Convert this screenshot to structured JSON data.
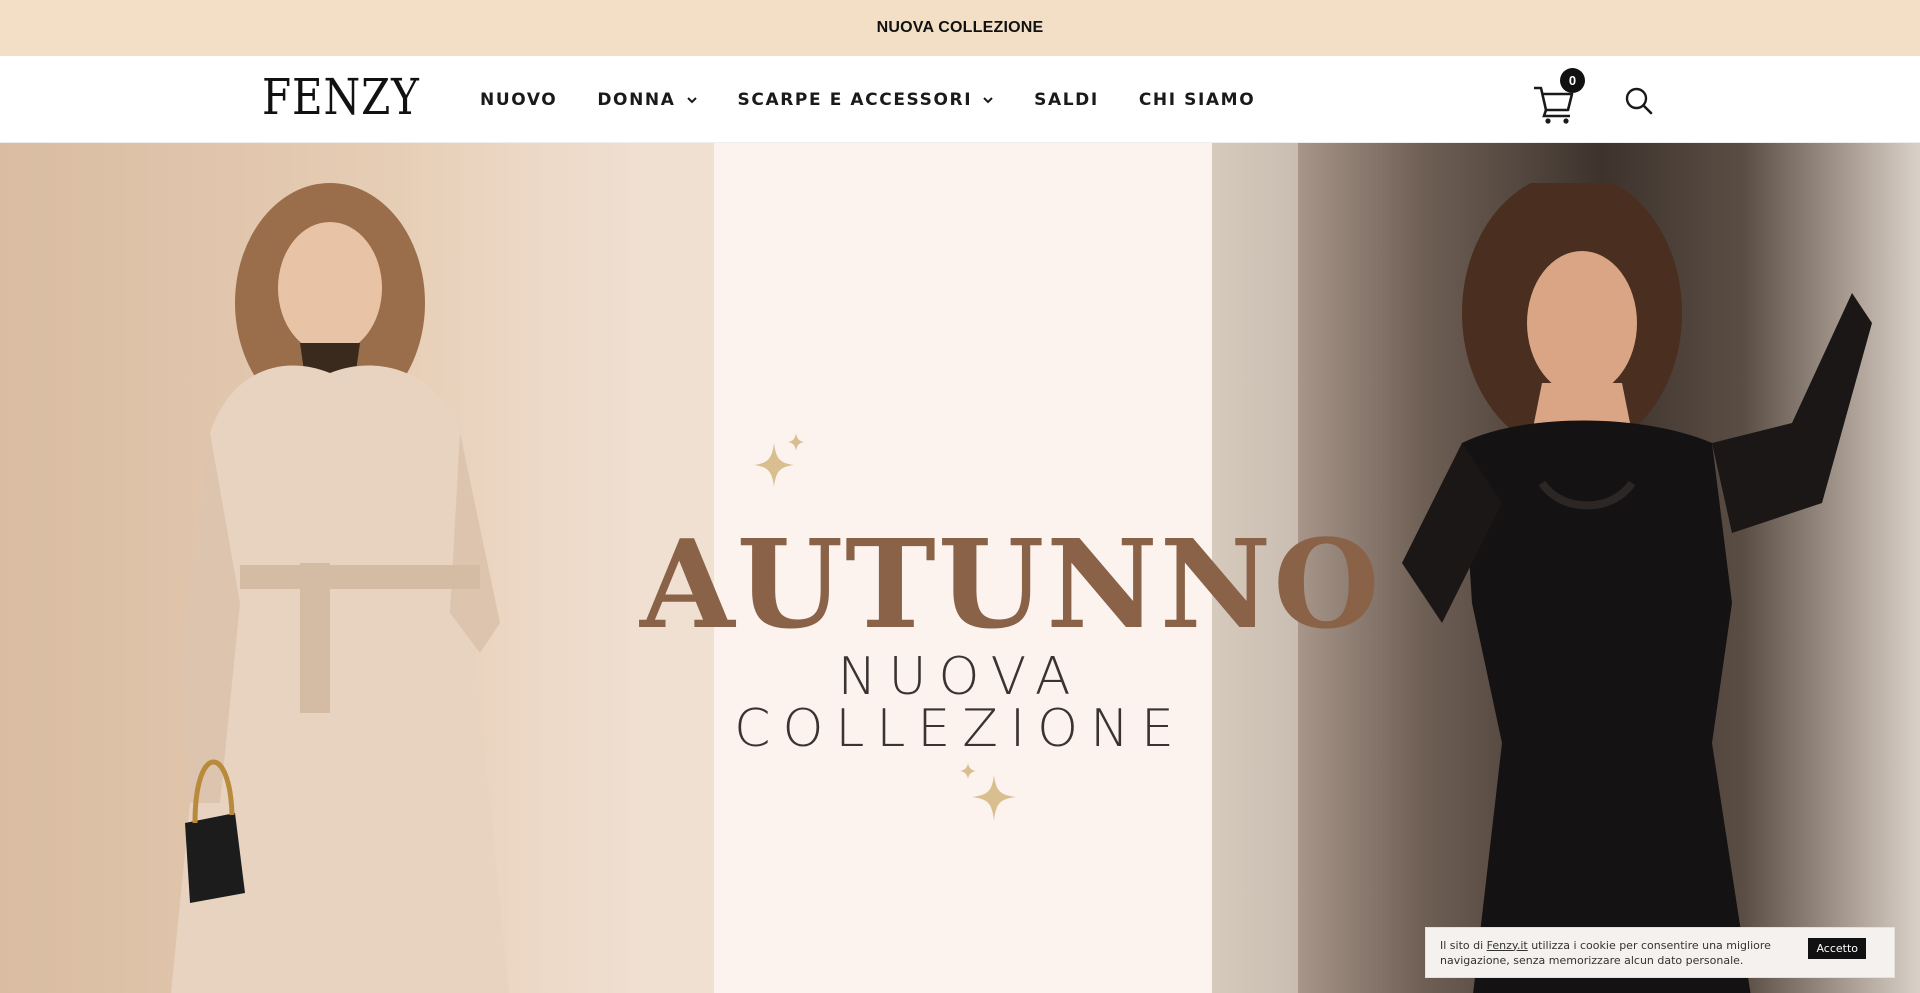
{
  "announcement": {
    "text": "NUOVA COLLEZIONE"
  },
  "header": {
    "logo": "FENZY",
    "nav": [
      {
        "label": "NUOVO",
        "has_dropdown": false
      },
      {
        "label": "DONNA",
        "has_dropdown": true
      },
      {
        "label": "SCARPE E ACCESSORI",
        "has_dropdown": true
      },
      {
        "label": "SALDI",
        "has_dropdown": false
      },
      {
        "label": "CHI SIAMO",
        "has_dropdown": false
      }
    ],
    "cart_count": "0",
    "icons": {
      "cart": "cart-icon",
      "search": "search-icon",
      "dropdown": "chevron-down-icon"
    }
  },
  "hero": {
    "title": "AUTUNNO",
    "subtitle": "NUOVA COLLEZIONE",
    "colors": {
      "title": "#8a6248",
      "background": "#fcf3ef",
      "sparkle": "#d4b78a"
    }
  },
  "cookie": {
    "text_before": "Il sito di ",
    "link": "Fenzy.it",
    "text_after": " utilizza i cookie per consentire una migliore navigazione, senza memorizzare alcun dato personale.",
    "button": "Accetto"
  },
  "colors": {
    "announcement_bg": "#f2dfc6"
  }
}
